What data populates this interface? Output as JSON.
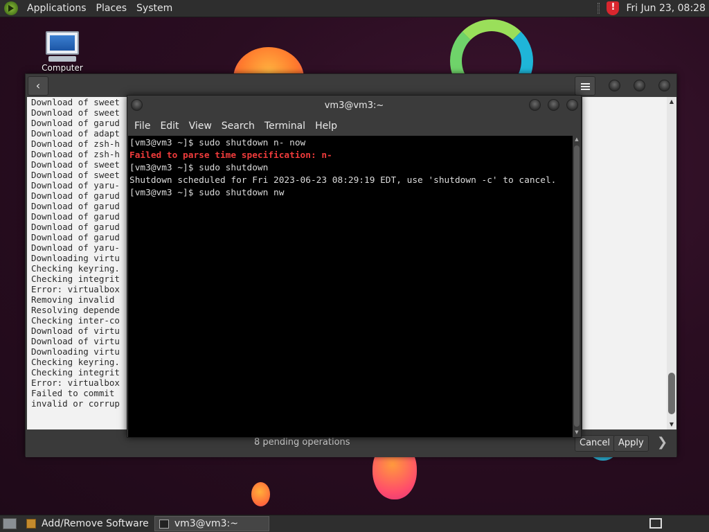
{
  "top_panel": {
    "menus": [
      "Applications",
      "Places",
      "System"
    ],
    "clock": "Fri Jun 23, 08:28"
  },
  "desktop": {
    "icons": [
      {
        "label": "Computer",
        "icon": "computer-icon"
      }
    ]
  },
  "software_window": {
    "log_lines": [
      "Download of sweet",
      "Download of sweet",
      "Download of garud",
      "Download of adapt",
      "Download of zsh-h",
      "Download of zsh-h",
      "Download of sweet",
      "Download of sweet",
      "Download of yaru-",
      "Download of garud",
      "Download of garud",
      "Download of garud",
      "Download of garud",
      "Download of garud",
      "Download of yaru-",
      "Downloading virtu",
      "Checking keyring.",
      "Checking integrit",
      "Error: virtualbox",
      "Removing invalid",
      "Resolving depende",
      "Checking inter-co",
      "Download of virtu",
      "Download of virtu",
      "Downloading virtu",
      "Checking keyring.",
      "Checking integrit",
      "Error: virtualbox",
      "Failed to commit",
      "invalid or corrup"
    ],
    "pending_text": "8 pending operations",
    "cancel_label": "Cancel",
    "apply_label": "Apply"
  },
  "terminal": {
    "title": "vm3@vm3:~",
    "menu": [
      "File",
      "Edit",
      "View",
      "Search",
      "Terminal",
      "Help"
    ],
    "lines": [
      {
        "text": "[vm3@vm3 ~]$ sudo shutdown n- now",
        "style": "normal"
      },
      {
        "text": "Failed to parse time specification: n-",
        "style": "error"
      },
      {
        "text": "[vm3@vm3 ~]$ sudo shutdown",
        "style": "normal"
      },
      {
        "text": "Shutdown scheduled for Fri 2023-06-23 08:29:19 EDT, use 'shutdown -c' to cancel.",
        "style": "normal"
      },
      {
        "text": "[vm3@vm3 ~]$ sudo shutdown nw",
        "style": "normal"
      }
    ]
  },
  "taskbar": {
    "tasks": [
      {
        "label": "Add/Remove Software",
        "icon": "package-icon",
        "active": false
      },
      {
        "label": "vm3@vm3:~",
        "icon": "terminal-icon",
        "active": true
      }
    ]
  },
  "colors": {
    "error_text": "#ef3b3b",
    "panel_bg": "#2e2e2e",
    "terminal_bg": "#000000"
  }
}
